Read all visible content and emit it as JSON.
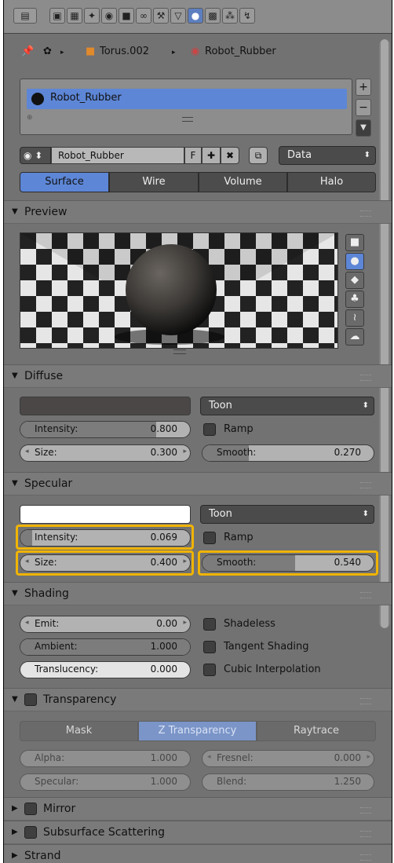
{
  "breadcrumb": {
    "object": "Torus.002",
    "material": "Robot_Rubber"
  },
  "material_slots": {
    "items": [
      "Robot_Rubber"
    ]
  },
  "material_selector": {
    "name": "Robot_Rubber",
    "fake_user": "F",
    "link": "Data"
  },
  "tabs": [
    "Surface",
    "Wire",
    "Volume",
    "Halo"
  ],
  "active_tab": "Surface",
  "panels": {
    "preview": {
      "title": "Preview"
    },
    "diffuse": {
      "title": "Diffuse",
      "shader": "Toon",
      "intensity": {
        "label": "Intensity:",
        "value": "0.800"
      },
      "ramp": "Ramp",
      "size": {
        "label": "Size:",
        "value": "0.300"
      },
      "smooth": {
        "label": "Smooth:",
        "value": "0.270"
      }
    },
    "specular": {
      "title": "Specular",
      "shader": "Toon",
      "intensity": {
        "label": "Intensity:",
        "value": "0.069"
      },
      "ramp": "Ramp",
      "size": {
        "label": "Size:",
        "value": "0.400"
      },
      "smooth": {
        "label": "Smooth:",
        "value": "0.540"
      }
    },
    "shading": {
      "title": "Shading",
      "emit": {
        "label": "Emit:",
        "value": "0.00"
      },
      "ambient": {
        "label": "Ambient:",
        "value": "1.000"
      },
      "translucency": {
        "label": "Translucency:",
        "value": "0.000"
      },
      "shadeless": "Shadeless",
      "tangent": "Tangent Shading",
      "cubic": "Cubic Interpolation"
    },
    "transparency": {
      "title": "Transparency",
      "modes": [
        "Mask",
        "Z Transparency",
        "Raytrace"
      ],
      "active_mode": "Z Transparency",
      "alpha": {
        "label": "Alpha:",
        "value": "1.000"
      },
      "fresnel": {
        "label": "Fresnel:",
        "value": "0.000"
      },
      "specular": {
        "label": "Specular:",
        "value": "1.000"
      },
      "blend": {
        "label": "Blend:",
        "value": "1.250"
      }
    },
    "mirror": {
      "title": "Mirror"
    },
    "sss": {
      "title": "Subsurface Scattering"
    },
    "strand": {
      "title": "Strand"
    }
  },
  "slider_fill": {
    "diffuse_intensity": 0.8,
    "diffuse_smooth": 0.27,
    "specular_intensity": 0.069,
    "specular_smooth": 0.54,
    "ambient": 1.0,
    "translucency": 0.0
  },
  "colors": {
    "accent": "#5d86d6",
    "highlight": "#f0b400",
    "panel": "#727272"
  }
}
